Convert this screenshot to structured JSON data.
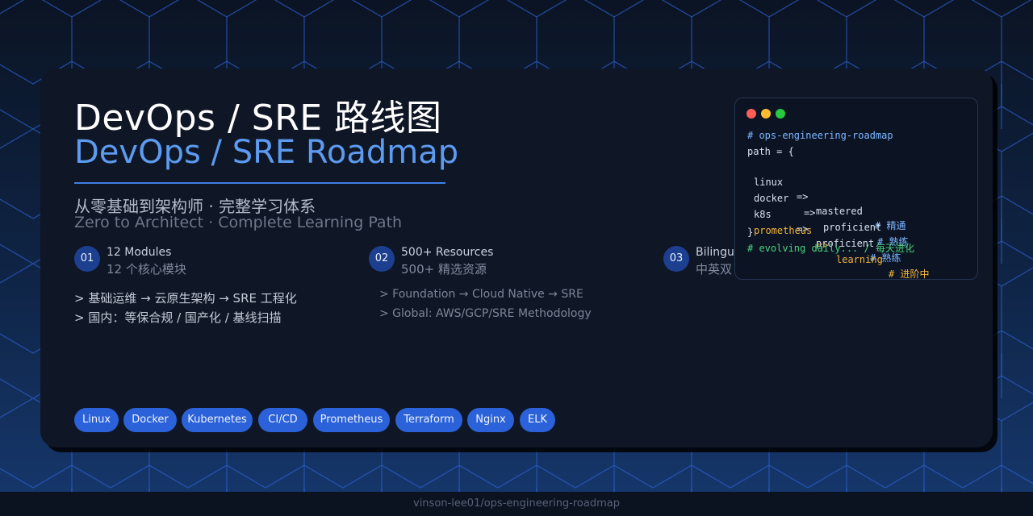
{
  "title": {
    "cn": "DevOps / SRE 路线图",
    "en": "DevOps / SRE Roadmap"
  },
  "subtitle": {
    "cn": "从零基础到架构师 · 完整学习体系",
    "en": "Zero to Architect · Complete Learning Path"
  },
  "features": [
    {
      "num": "01",
      "en": "12 Modules",
      "cn": "12 个核心模块"
    },
    {
      "num": "02",
      "en": "500+ Resources",
      "cn": "500+ 精选资源"
    },
    {
      "num": "03",
      "en": "Bilingual",
      "cn": "中英双"
    }
  ],
  "paths": {
    "cn": [
      "> 基础运维 → 云原生架构 → SRE 工程化",
      "> 国内：等保合规 / 国产化 / 基线扫描"
    ],
    "en": [
      "> Foundation → Cloud Native → SRE",
      "> Global: AWS/GCP/SRE Methodology"
    ]
  },
  "code": {
    "comment": "# ops-engineering-roadmap",
    "open": "path = {",
    "rows": [
      {
        "key": "linux",
        "arrow": "=>",
        "value": "mastered",
        "note": "# 精通"
      },
      {
        "key": "docker",
        "arrow": "=>",
        "value": "proficient",
        "note": "# 熟练"
      },
      {
        "key": "k8s",
        "arrow": "=>",
        "value": "proficient",
        "note": "# 熟练"
      },
      {
        "key": "prometheus",
        "arrow": "=>",
        "value": "learning",
        "note": "# 进阶中"
      }
    ],
    "close": "}",
    "footer": "# evolving daily... / 每天进化"
  },
  "tags": [
    "Linux",
    "Docker",
    "Kubernetes",
    "CI/CD",
    "Prometheus",
    "Terraform",
    "Nginx",
    "ELK"
  ],
  "footer": "vinson-lee01/ops-engineering-roadmap",
  "colors": {
    "accent": "#5c9bf0",
    "tag": "#2b62d9",
    "warm": "#f1b43c",
    "green": "#47d17a",
    "dot_red": "#ff5f57",
    "dot_yellow": "#febc2e",
    "dot_green": "#28c840"
  }
}
